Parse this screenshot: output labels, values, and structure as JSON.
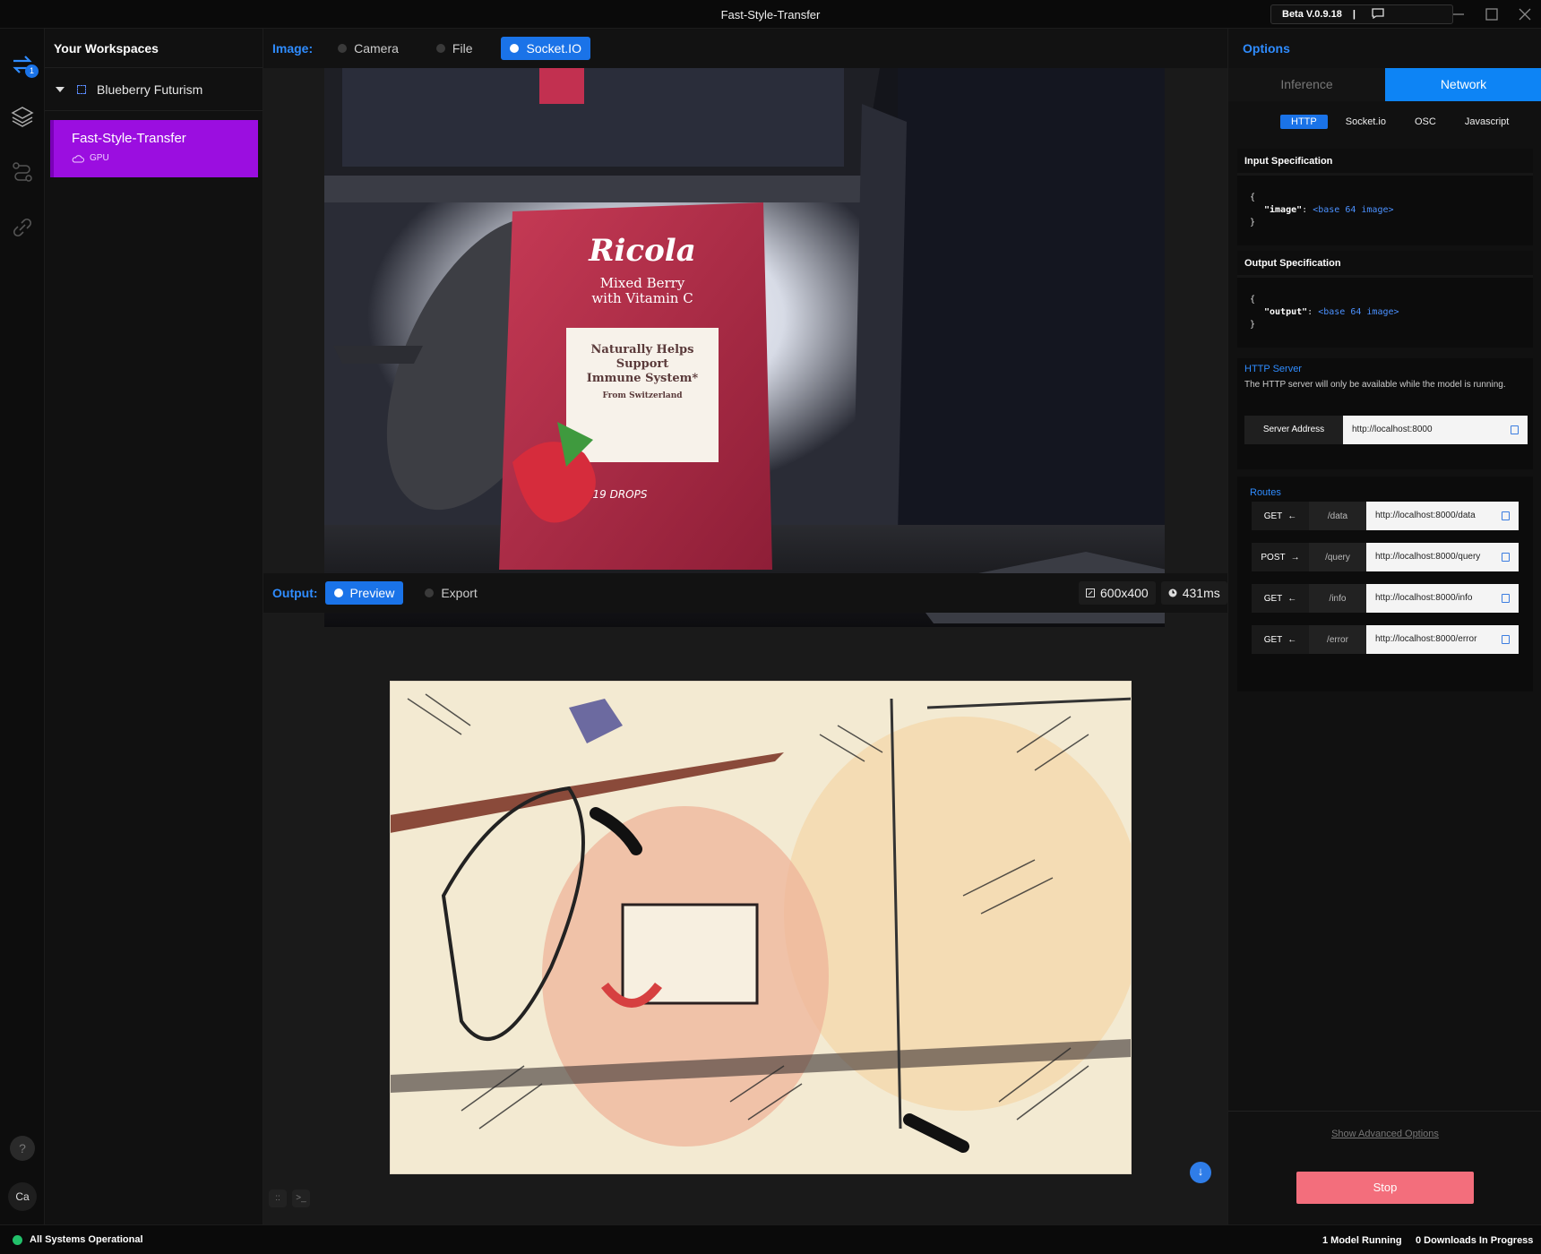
{
  "window": {
    "title": "Fast-Style-Transfer",
    "version_label": "Beta V.0.9.18"
  },
  "rail": {
    "badge_count": "1",
    "help_label": "?",
    "avatar_initials": "Ca"
  },
  "workspaces": {
    "header": "Your Workspaces",
    "workspace_name": "Blueberry Futurism",
    "model_name": "Fast-Style-Transfer",
    "model_runtime": "GPU"
  },
  "image_bar": {
    "label": "Image:",
    "tabs": [
      "Camera",
      "File",
      "Socket.IO"
    ],
    "active_tab": "Socket.IO"
  },
  "output_bar": {
    "label": "Output:",
    "preview_label": "Preview",
    "export_label": "Export",
    "resolution": "600x400",
    "latency": "431ms"
  },
  "input_image": {
    "bag_brand": "Ricola",
    "bag_line1": "Mixed Berry",
    "bag_line2": "with Vitamin C",
    "bag_claim1": "Naturally Helps",
    "bag_claim2": "Support",
    "bag_claim3": "Immune System*",
    "bag_origin": "From Switzerland",
    "bag_count": "19 DROPS"
  },
  "options": {
    "header": "Options",
    "segments": [
      "Inference",
      "Network"
    ],
    "active_segment": "Network",
    "subtabs": [
      "HTTP",
      "Socket.io",
      "OSC",
      "Javascript"
    ],
    "active_subtab": "HTTP",
    "input_spec": {
      "title": "Input Specification",
      "open": "{",
      "key": "\"image\"",
      "value": "<base 64 image>",
      "close": "}"
    },
    "output_spec": {
      "title": "Output Specification",
      "open": "{",
      "key": "\"output\"",
      "value": "<base 64 image>",
      "close": "}"
    },
    "http_server": {
      "title": "HTTP Server",
      "description": "The HTTP server will only be available while the model is running.",
      "address_label": "Server Address",
      "address": "http://localhost:8000"
    },
    "routes": {
      "title": "Routes",
      "items": [
        {
          "method": "GET",
          "arrow": "←",
          "path": "/data",
          "url": "http://localhost:8000/data"
        },
        {
          "method": "POST",
          "arrow": "→",
          "path": "/query",
          "url": "http://localhost:8000/query"
        },
        {
          "method": "GET",
          "arrow": "←",
          "path": "/info",
          "url": "http://localhost:8000/info"
        },
        {
          "method": "GET",
          "arrow": "←",
          "path": "/error",
          "url": "http://localhost:8000/error"
        }
      ]
    },
    "advanced_link": "Show Advanced Options",
    "stop_label": "Stop"
  },
  "status": {
    "system": "All Systems Operational",
    "models": "1 Model Running",
    "downloads": "0 Downloads In Progress"
  },
  "colors": {
    "accent_blue": "#1a73e8",
    "model_card": "#9b0ee0",
    "stop_button": "#f36e7c",
    "status_ok": "#22c06a"
  }
}
